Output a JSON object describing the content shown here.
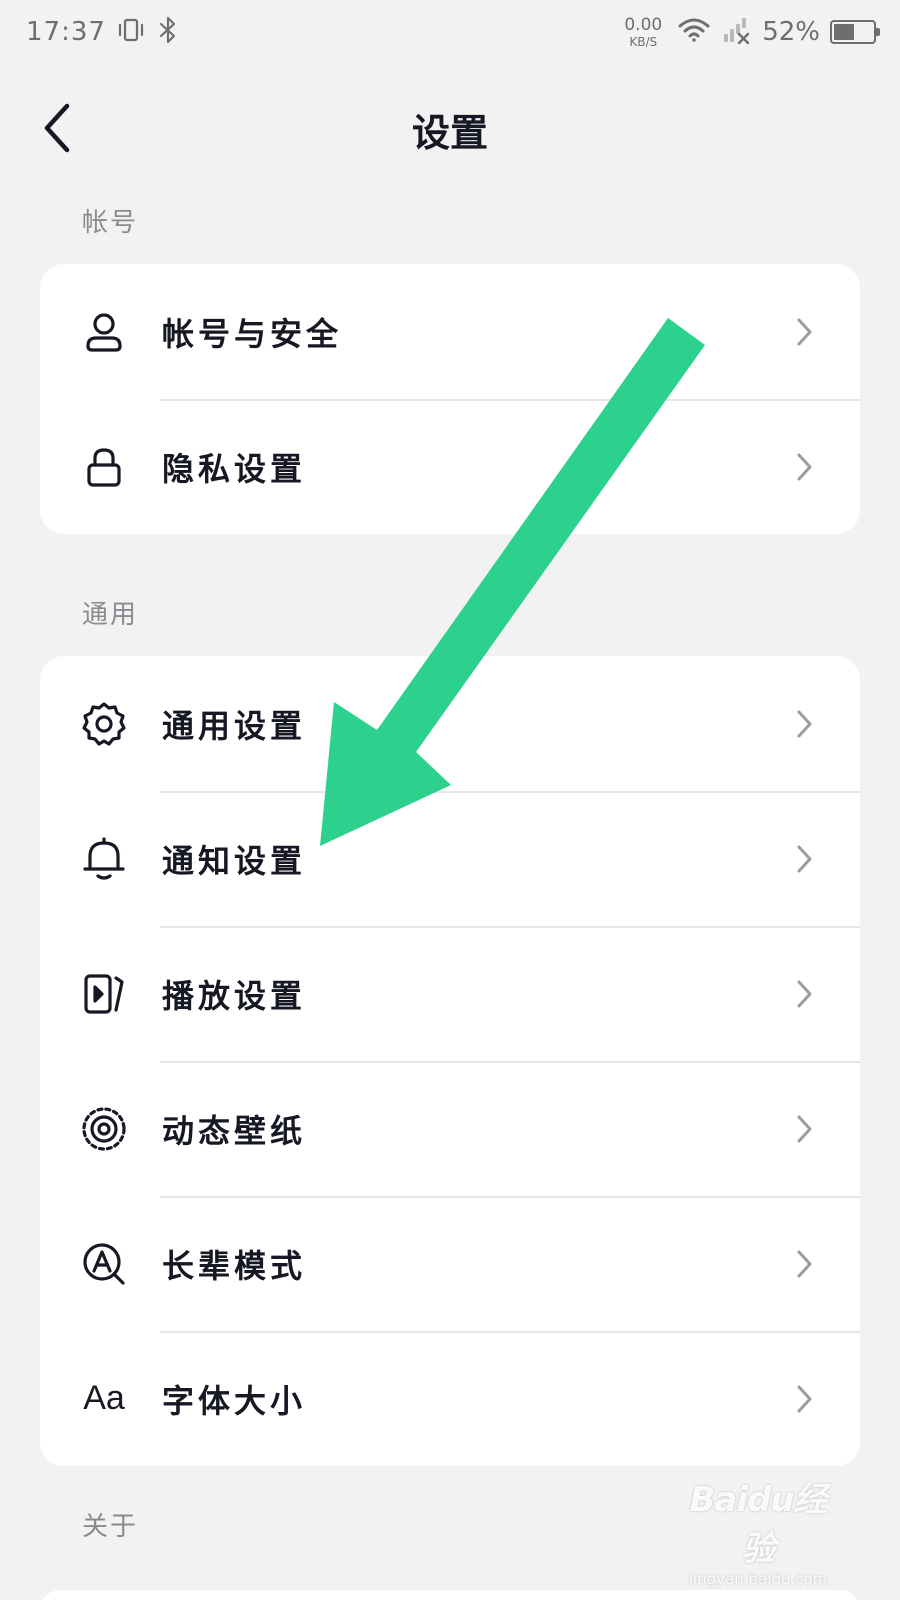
{
  "status_bar": {
    "time": "17:37",
    "net_speed_value": "0.00",
    "net_speed_unit": "KB/S",
    "battery_percent": "52%",
    "battery_level": 0.52,
    "icons": [
      "vibrate-icon",
      "bluetooth-icon",
      "wifi-icon",
      "signal-no-service-icon",
      "battery-icon"
    ]
  },
  "header": {
    "title": "设置",
    "back_icon": "chevron-left-icon"
  },
  "sections": [
    {
      "label": "帐号",
      "items": [
        {
          "label": "帐号与安全",
          "icon": "user-icon"
        },
        {
          "label": "隐私设置",
          "icon": "lock-icon"
        }
      ]
    },
    {
      "label": "通用",
      "items": [
        {
          "label": "通用设置",
          "icon": "gear-icon"
        },
        {
          "label": "通知设置",
          "icon": "bell-icon"
        },
        {
          "label": "播放设置",
          "icon": "play-card-icon"
        },
        {
          "label": "动态壁纸",
          "icon": "live-wallpaper-icon"
        },
        {
          "label": "长辈模式",
          "icon": "elder-mode-icon"
        },
        {
          "label": "字体大小",
          "icon": "font-size-icon",
          "icon_text": "Aa"
        }
      ]
    },
    {
      "label": "关于"
    }
  ],
  "annotation": {
    "arrow_color": "#2bd18c",
    "points_to": "通知设置"
  },
  "watermark": {
    "logo": "Baidu经验",
    "url": "jingyan.baidu.com"
  },
  "colors": {
    "background": "#f2f2f2",
    "card": "#ffffff",
    "text_primary": "#161823",
    "text_secondary": "#8a8b91",
    "divider": "#e5e5e7",
    "chevron": "#9b9ca1"
  }
}
